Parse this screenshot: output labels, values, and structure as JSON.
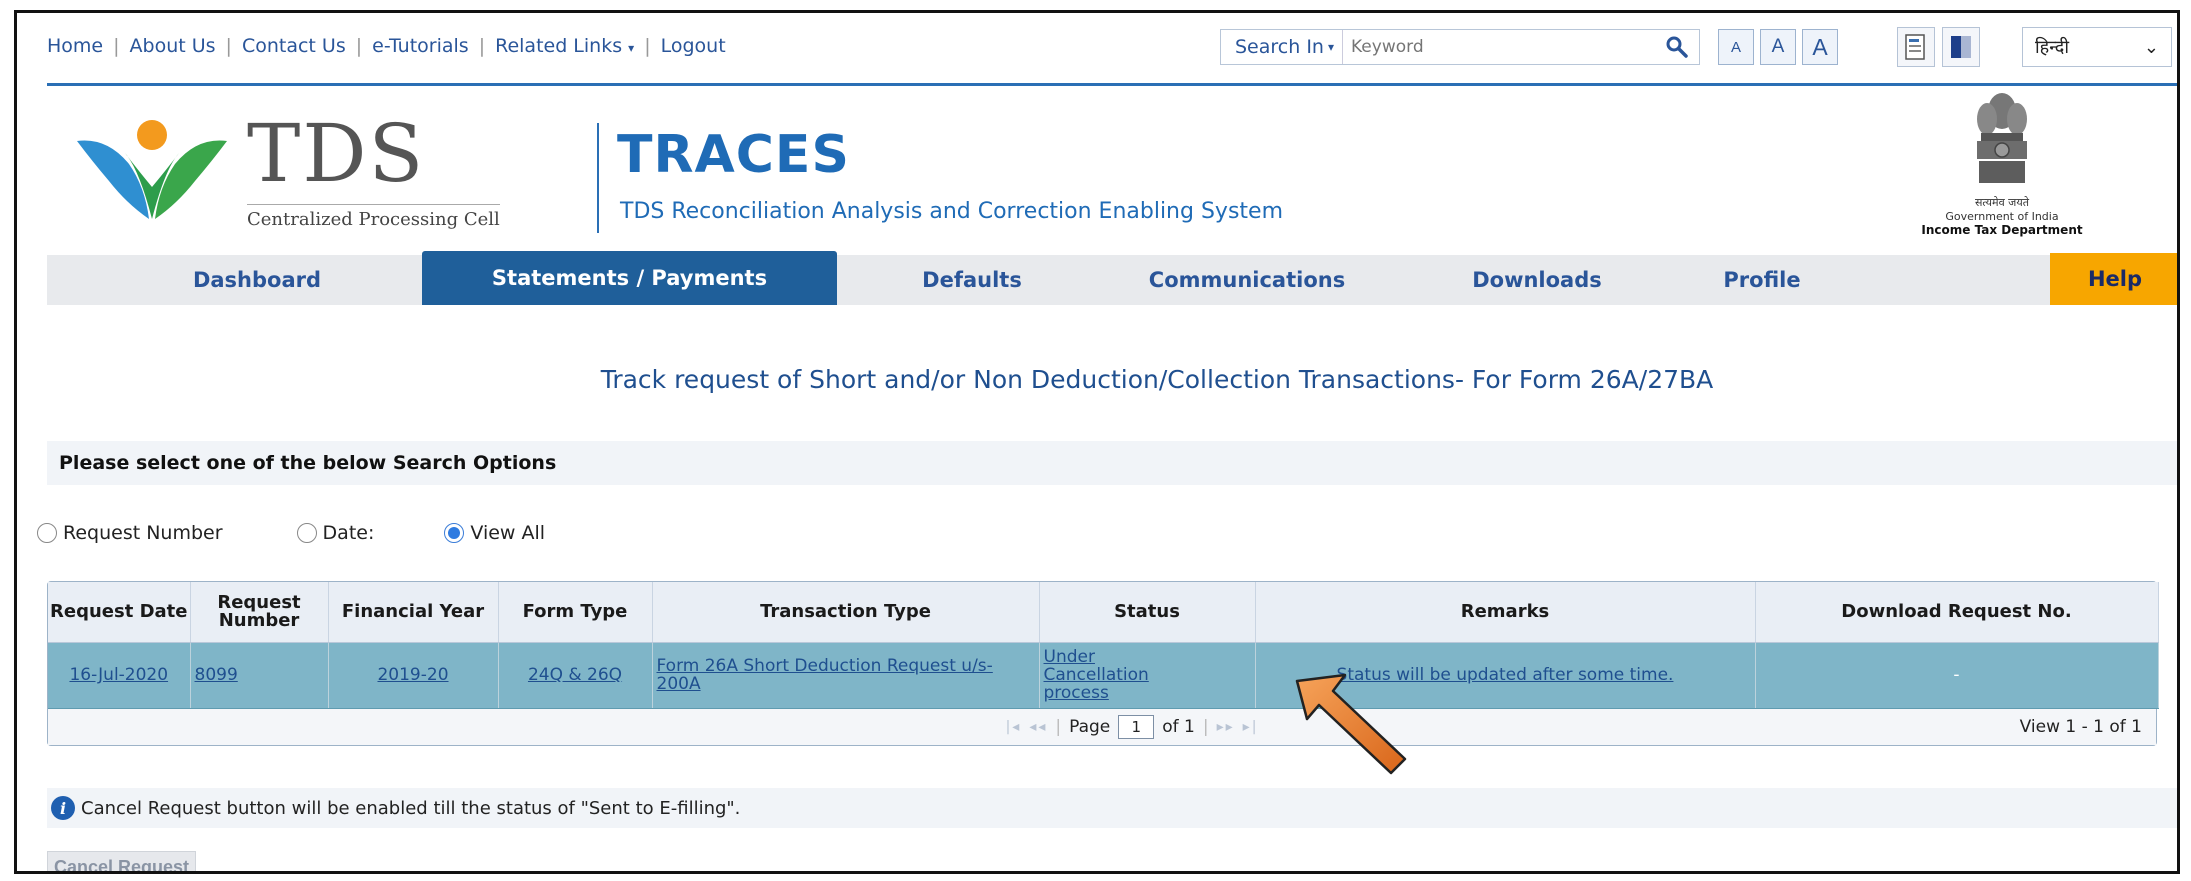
{
  "toplinks": {
    "home": "Home",
    "about": "About Us",
    "contact": "Contact Us",
    "tutorials": "e-Tutorials",
    "related": "Related Links",
    "logout": "Logout"
  },
  "search": {
    "select_label": "Search In",
    "placeholder": "Keyword"
  },
  "font_sizes": [
    "A",
    "A",
    "A"
  ],
  "language": "हिन्दी",
  "header": {
    "tds_logo_text": "TDS",
    "tds_logo_sub": "Centralized Processing Cell",
    "app_name": "TRACES",
    "app_full_name": "TDS Reconciliation Analysis and Correction Enabling System",
    "emblem_motto": "सत्यमेव जयते",
    "emblem_gov": "Government of India",
    "emblem_dept": "Income Tax Department"
  },
  "nav": {
    "items": [
      {
        "label": "Dashboard"
      },
      {
        "label": "Statements / Payments"
      },
      {
        "label": "Defaults"
      },
      {
        "label": "Communications"
      },
      {
        "label": "Downloads"
      },
      {
        "label": "Profile"
      },
      {
        "label": "Help"
      }
    ],
    "active_index": 1
  },
  "page": {
    "title": "Track request of Short and/or Non Deduction/Collection Transactions- For Form 26A/27BA",
    "search_options_heading": "Please select one of the below Search Options",
    "radio_options": [
      "Request Number",
      "Date:",
      "View All"
    ],
    "selected_radio": "View All"
  },
  "table": {
    "headers": [
      "Request Date",
      "Request Number",
      "Financial Year",
      "Form Type",
      "Transaction Type",
      "Status",
      "Remarks",
      "Download Request No."
    ],
    "rows": [
      {
        "request_date": "16-Jul-2020",
        "request_number": "8099",
        "financial_year": "2019-20",
        "form_type": "24Q & 26Q",
        "transaction_type": "Form 26A Short Deduction Request u/s-200A",
        "status": "Under Cancellation process",
        "remarks": "Status will be updated after some time.",
        "download_request_no": "-"
      }
    ],
    "pager": {
      "page_label": "Page",
      "page_value": "1",
      "of_label": "of 1",
      "view_count": "View 1 - 1 of 1"
    }
  },
  "note": "Cancel Request button will be enabled till the status of \"Sent to E-filling\".",
  "cancel_button": "Cancel Request",
  "colors": {
    "brand_blue": "#1f6bb6",
    "active_tab": "#1f5f9a",
    "help_tab": "#f7a600",
    "selected_row": "#7fb5c8",
    "arrow": "#e07a1f"
  }
}
